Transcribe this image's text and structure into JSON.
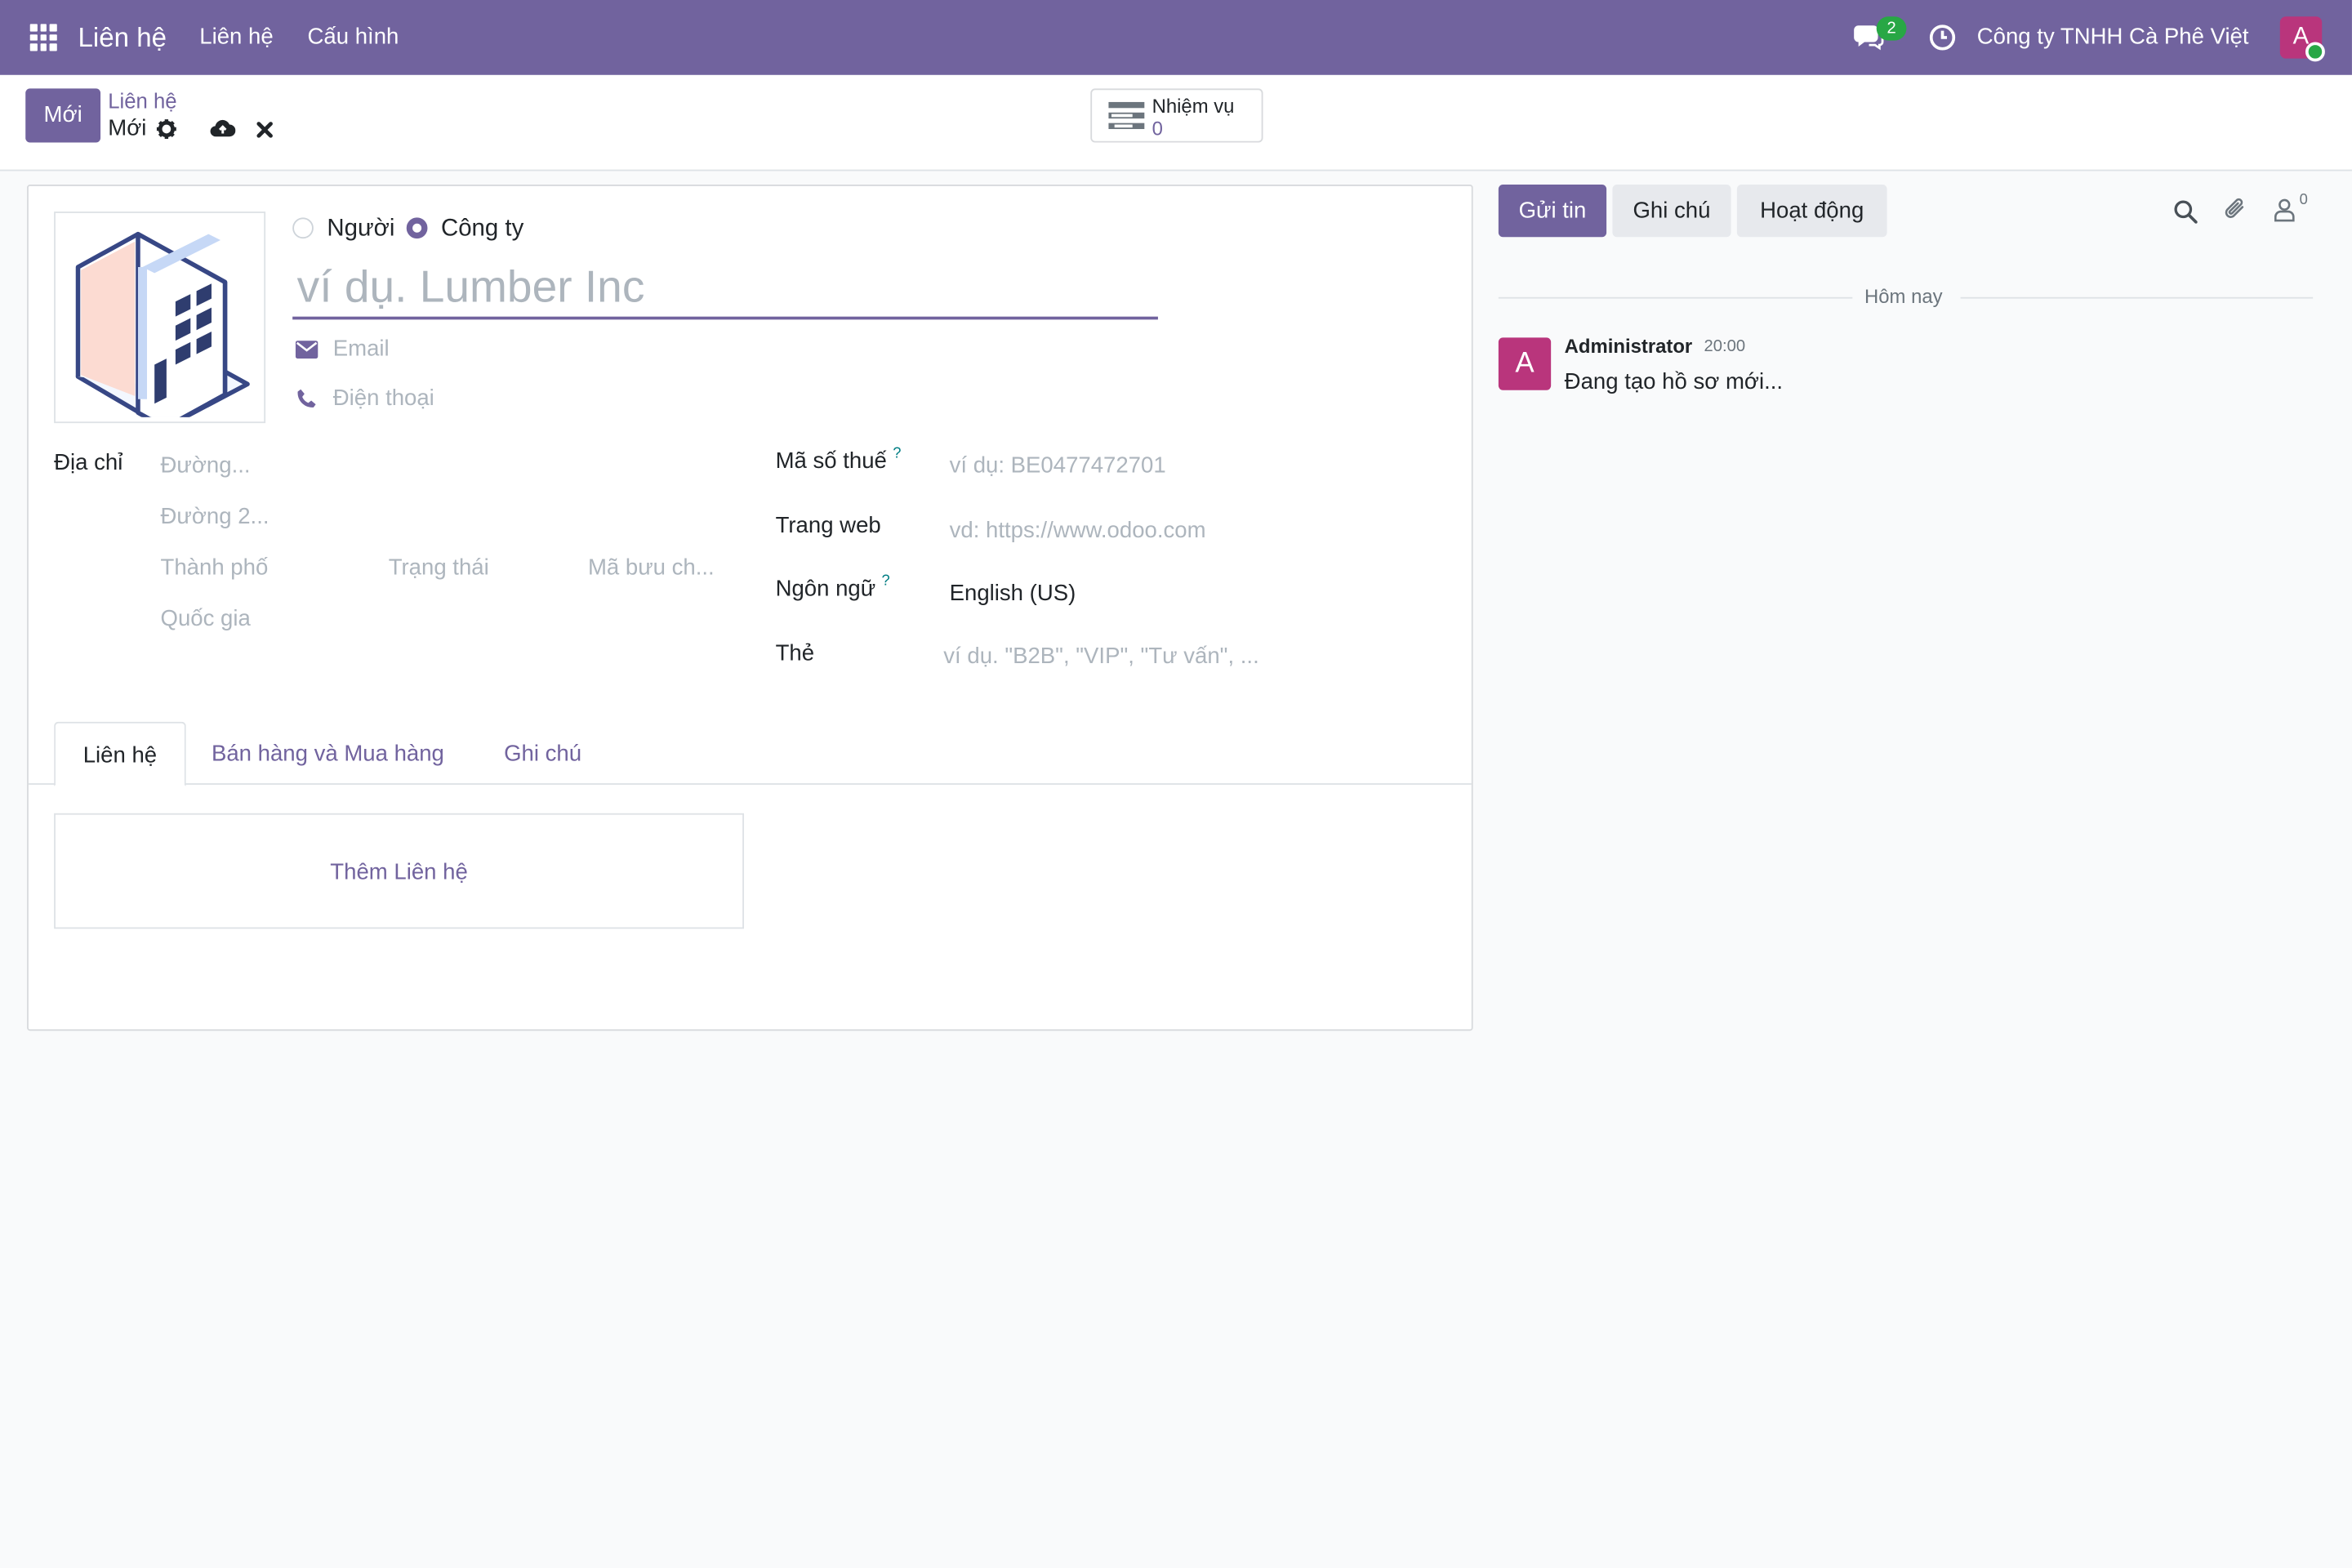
{
  "navbar": {
    "app_name": "Liên hệ",
    "menu": [
      "Liên hệ",
      "Cấu hình"
    ],
    "message_count": "2",
    "company": "Công ty TNHH Cà Phê Việt",
    "avatar_letter": "A",
    "colors": {
      "navbar": "#71639e",
      "badge": "#28a745",
      "avatar": "#b9357c"
    }
  },
  "control_panel": {
    "new_button": "Mới",
    "breadcrumb_parent": "Liên hệ",
    "breadcrumb_current": "Mới",
    "tasks_label": "Nhiệm vụ",
    "tasks_count": "0"
  },
  "form": {
    "type_options": [
      "Người",
      "Công ty"
    ],
    "type_selected": "Công ty",
    "name_placeholder": "ví dụ. Lumber Inc",
    "email_placeholder": "Email",
    "phone_placeholder": "Điện thoại",
    "address": {
      "label": "Địa chỉ",
      "street": "Đường...",
      "street2": "Đường 2...",
      "city": "Thành phố",
      "state": "Trạng thái",
      "zip": "Mã bưu ch...",
      "country": "Quốc gia"
    },
    "vat": {
      "label": "Mã số thuế",
      "help": "?",
      "placeholder": "ví dụ: BE0477472701"
    },
    "website": {
      "label": "Trang web",
      "placeholder": "vd: https://www.odoo.com"
    },
    "language": {
      "label": "Ngôn ngữ",
      "help": "?",
      "value": "English (US)"
    },
    "tags": {
      "label": "Thẻ",
      "placeholder": "ví dụ. \"B2B\", \"VIP\", \"Tư vấn\", ..."
    },
    "tabs": [
      "Liên hệ",
      "Bán hàng và Mua hàng",
      "Ghi chú"
    ],
    "active_tab": "Liên hệ",
    "add_contact": "Thêm Liên hệ"
  },
  "chatter": {
    "send_message": "Gửi tin",
    "log_note": "Ghi chú",
    "activity": "Hoạt động",
    "follower_count": "0",
    "date_separator": "Hôm nay",
    "messages": [
      {
        "author": "Administrator",
        "time": "20:00",
        "body": "Đang tạo hồ sơ mới...",
        "avatar_letter": "A"
      }
    ]
  }
}
